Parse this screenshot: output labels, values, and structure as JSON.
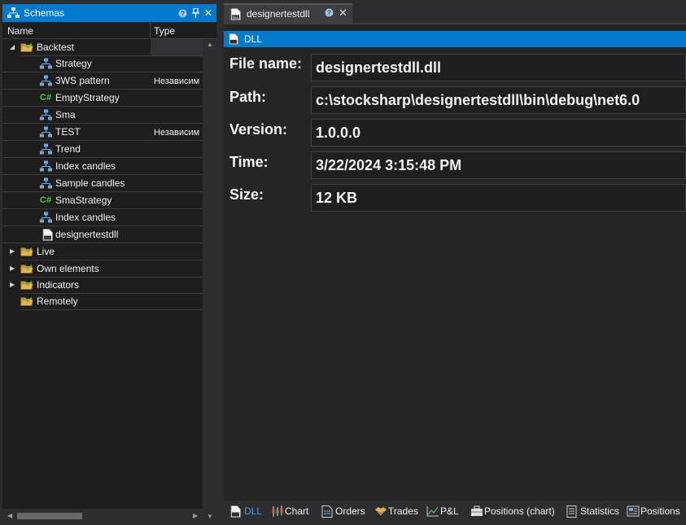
{
  "left_panel": {
    "title": "Schemas",
    "help_glyph": "?",
    "pin_glyph": "⊥",
    "close_glyph": "✕",
    "columns": {
      "name": "Name",
      "type": "Type"
    },
    "tree": [
      {
        "label": "Backtest",
        "kind": "folder-open",
        "expander": "◢",
        "level": 0
      },
      {
        "label": "Strategy",
        "kind": "diagram",
        "type": "",
        "level": 1
      },
      {
        "label": "3WS pattern",
        "kind": "diagram",
        "type": "Независим",
        "level": 1
      },
      {
        "label": "EmptyStrategy",
        "kind": "csharp",
        "type": "",
        "level": 1
      },
      {
        "label": "Sma",
        "kind": "diagram",
        "type": "",
        "level": 1
      },
      {
        "label": "TEST",
        "kind": "diagram",
        "type": "Независим",
        "level": 1
      },
      {
        "label": "Trend",
        "kind": "diagram",
        "type": "",
        "level": 1
      },
      {
        "label": "Index candles",
        "kind": "diagram",
        "type": "",
        "level": 1
      },
      {
        "label": "Sample candles",
        "kind": "diagram",
        "type": "",
        "level": 1
      },
      {
        "label": "SmaStrategy",
        "kind": "csharp",
        "type": "",
        "level": 1
      },
      {
        "label": "Index candles",
        "kind": "diagram",
        "type": "",
        "level": 1
      },
      {
        "label": "designertestdll",
        "kind": "dll",
        "type": "",
        "level": 1
      },
      {
        "label": "Live",
        "kind": "folder",
        "expander": "▶",
        "level": 0
      },
      {
        "label": "Own elements",
        "kind": "folder",
        "expander": "▶",
        "level": 0
      },
      {
        "label": "Indicators",
        "kind": "folder",
        "expander": "▶",
        "level": 0
      },
      {
        "label": "Remotely",
        "kind": "folder",
        "expander": "",
        "level": 0
      }
    ],
    "csharp_glyph": "C#"
  },
  "document": {
    "tab_title": "designertestdll",
    "tab_help_glyph": "?",
    "tab_close_glyph": "✕",
    "header_title": "DLL",
    "properties": [
      {
        "key": "File name:",
        "value": "designertestdll.dll"
      },
      {
        "key": "Path:",
        "value": "c:\\stocksharp\\designertestdll\\bin\\debug\\net6.0"
      },
      {
        "key": "Version:",
        "value": "1.0.0.0"
      },
      {
        "key": "Time:",
        "value": "3/22/2024 3:15:48 PM"
      },
      {
        "key": "Size:",
        "value": "12 KB"
      }
    ]
  },
  "bottom_tabs": [
    {
      "label": "DLL",
      "icon": "dll-icon",
      "active": true
    },
    {
      "label": "Chart",
      "icon": "candlestick-chart-icon",
      "active": false
    },
    {
      "label": "Orders",
      "icon": "orders-icon",
      "active": false
    },
    {
      "label": "Trades",
      "icon": "handshake-icon",
      "active": false
    },
    {
      "label": "P&L",
      "icon": "pnl-chart-icon",
      "active": false
    },
    {
      "label": "Positions (chart)",
      "icon": "briefcase-icon",
      "active": false
    },
    {
      "label": "Statistics",
      "icon": "statistics-icon",
      "active": false
    },
    {
      "label": "Positions",
      "icon": "positions-icon",
      "active": false
    }
  ],
  "colors": {
    "accent": "#007acc",
    "active_tab_text": "#3aa0ff",
    "folder": "#e8b24a",
    "diagram_icon": "#6fa8dc",
    "csharp_icon": "#4ec94e"
  }
}
